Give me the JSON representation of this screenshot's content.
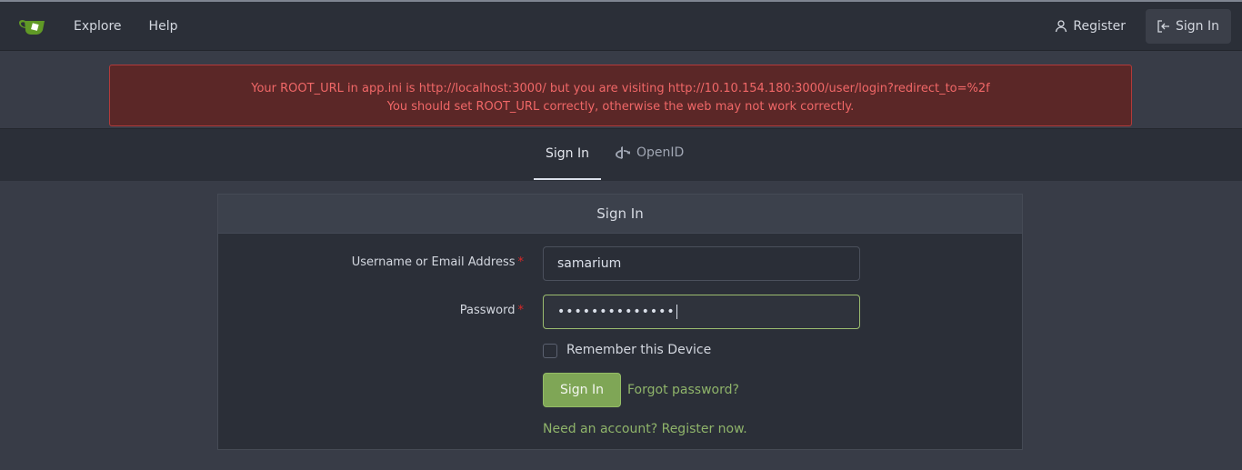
{
  "colors": {
    "accent": "#7fa656",
    "link": "#8fb46a",
    "alert_text": "#f06767",
    "alert_bg": "#5b2727"
  },
  "navbar": {
    "logo_icon": "gitea-tea-cup-icon",
    "links": [
      "Explore",
      "Help"
    ],
    "register_label": "Register",
    "signin_label": "Sign In"
  },
  "alert": {
    "line1": "Your ROOT_URL in app.ini is http://localhost:3000/ but you are visiting http://10.10.154.180:3000/user/login?redirect_to=%2f",
    "line2": "You should set ROOT_URL correctly, otherwise the web may not work correctly."
  },
  "tabs": [
    {
      "label": "Sign In",
      "active": true
    },
    {
      "label": "OpenID",
      "icon": "openid-icon"
    }
  ],
  "form": {
    "title": "Sign In",
    "username_label": "Username or Email Address",
    "username_value": "samarium",
    "password_label": "Password",
    "password_value": "••••••••••••••",
    "required_mark": "*",
    "remember_label": "Remember this Device",
    "submit_label": "Sign In",
    "forgot_label": "Forgot password?",
    "need_account_label": "Need an account? Register now."
  }
}
